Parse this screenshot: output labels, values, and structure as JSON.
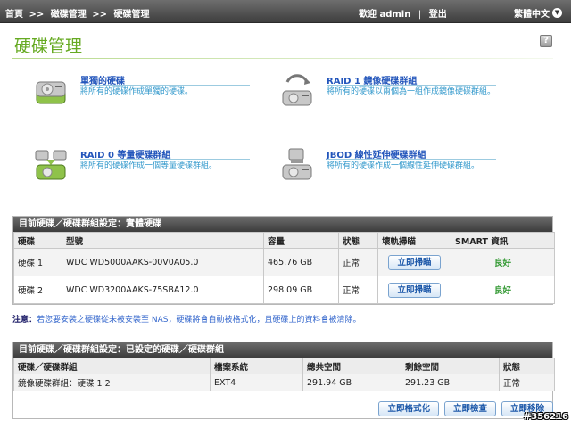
{
  "topbar": {
    "crumb_home": "首頁",
    "crumb_sep1": ">>",
    "crumb_disk": "磁碟管理",
    "crumb_sep2": ">>",
    "crumb_current": "硬碟管理",
    "welcome": "歡迎 admin",
    "divider": "|",
    "logout": "登出",
    "language": "繁體中文"
  },
  "page": {
    "title": "硬碟管理",
    "help_label": "?"
  },
  "options": [
    {
      "title": "單獨的硬碟",
      "desc": "將所有的硬碟作成單獨的硬碟。",
      "icon": "single-disk-icon"
    },
    {
      "title": "RAID 1 鏡像硬碟群組",
      "desc": "將所有的硬碟以兩個為一組作成鏡像硬碟群組。",
      "icon": "raid1-mirror-icon"
    },
    {
      "title": "RAID 0 等量硬碟群組",
      "desc": "將所有的硬碟作成一個等量硬碟群組。",
      "icon": "raid0-stripe-icon"
    },
    {
      "title": "JBOD 線性延伸硬碟群組",
      "desc": "將所有的硬碟作成一個線性延伸硬碟群組。",
      "icon": "jbod-linear-icon"
    }
  ],
  "disk_panel": {
    "heading": "目前硬碟／硬碟群組設定：實體硬碟",
    "columns": [
      "硬碟",
      "型號",
      "容量",
      "狀態",
      "壞軌掃瞄",
      "SMART 資訊"
    ],
    "rows": [
      {
        "disk": "硬碟 1",
        "model": "WDC WD5000AAKS-00V0A05.0",
        "capacity": "465.76 GB",
        "status": "正常",
        "scan_label": "立即掃瞄",
        "smart": "良好"
      },
      {
        "disk": "硬碟 2",
        "model": "WDC WD3200AAKS-75SBA12.0",
        "capacity": "298.09 GB",
        "status": "正常",
        "scan_label": "立即掃瞄",
        "smart": "良好"
      }
    ]
  },
  "notice": {
    "label": "注意：",
    "text": "若您要安裝之硬碟從未被安裝至 NAS，硬碟將會自動被格式化，且硬碟上的資料會被清除。"
  },
  "group_panel": {
    "heading": "目前硬碟／硬碟群組設定：已設定的硬碟／硬碟群組",
    "columns": [
      "硬碟／硬碟群組",
      "檔案系統",
      "總共空間",
      "剩餘空間",
      "狀態"
    ],
    "rows": [
      {
        "group": "鏡像硬碟群組：硬碟 1 2",
        "fs": "EXT4",
        "total": "291.94 GB",
        "free": "291.23 GB",
        "status": "正常"
      }
    ]
  },
  "actions": {
    "format": "立即格式化",
    "check": "立即檢查",
    "remove": "立即移除"
  },
  "watermark": "#356216",
  "colors": {
    "title_green": "#66aa22",
    "link_blue": "#2255bb",
    "desc_blue": "#3399cc",
    "smart_green": "#339933",
    "header_dark": "#4a4a4a"
  }
}
